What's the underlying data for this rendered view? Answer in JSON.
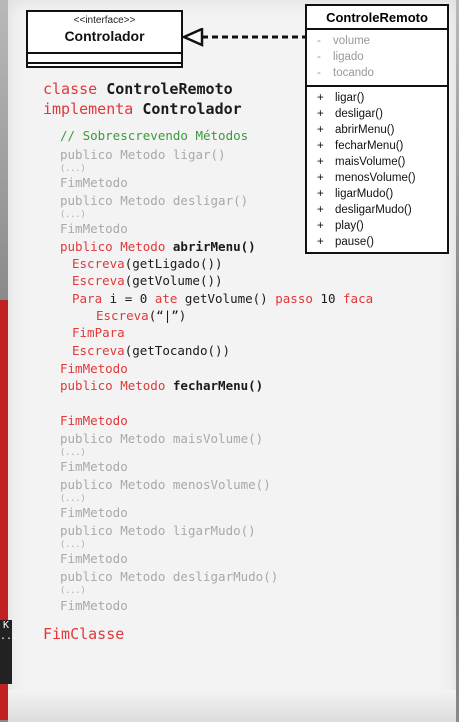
{
  "uml": {
    "interface": {
      "stereotype": "<<interface>>",
      "name": "Controlador"
    },
    "class": {
      "name": "ControleRemoto",
      "attributes": [
        {
          "symbol": "-",
          "name": "volume"
        },
        {
          "symbol": "-",
          "name": "ligado"
        },
        {
          "symbol": "-",
          "name": "tocando"
        }
      ],
      "methods": [
        {
          "symbol": "+",
          "name": "ligar()"
        },
        {
          "symbol": "+",
          "name": "desligar()"
        },
        {
          "symbol": "+",
          "name": "abrirMenu()"
        },
        {
          "symbol": "+",
          "name": "fecharMenu()"
        },
        {
          "symbol": "+",
          "name": "maisVolume()"
        },
        {
          "symbol": "+",
          "name": "menosVolume()"
        },
        {
          "symbol": "+",
          "name": "ligarMudo()"
        },
        {
          "symbol": "+",
          "name": "desligarMudo()"
        },
        {
          "symbol": "+",
          "name": "play()"
        },
        {
          "symbol": "+",
          "name": "pause()"
        }
      ]
    }
  },
  "code": {
    "class_kw": "classe",
    "class_name": "ControleRemoto",
    "implements_kw": "implementa",
    "iface_name": "Controlador",
    "comment": "// Sobrescrevendo Métodos",
    "m_ligar": "ligar()",
    "m_desligar": "desligar()",
    "m_abrirMenu": "abrirMenu()",
    "m_fecharMenu": "fecharMenu()",
    "m_maisVolume": "maisVolume()",
    "m_menosVolume": "menosVolume()",
    "m_ligarMudo": "ligarMudo()",
    "m_desligarMudo": "desligarMudo()",
    "publico_metodo": "publico Metodo",
    "ellipsis": "(...)",
    "fim_metodo": "FimMetodo",
    "escreva_kw": "Escreva",
    "escreva_ligado": "(getLigado())",
    "escreva_volume": "(getVolume())",
    "para_kw": "Para",
    "para_var": "i = 0",
    "ate_kw": "ate",
    "para_call": "getVolume()",
    "passo_kw": "passo",
    "passo_val": "10",
    "faca_kw": "faca",
    "escreva_bar": "(“|”)",
    "fim_para": "FimPara",
    "escreva_tocando": "(getTocando())",
    "fim_classe": "FimClasse"
  },
  "misc": {
    "cursor_label": "K\n..."
  }
}
